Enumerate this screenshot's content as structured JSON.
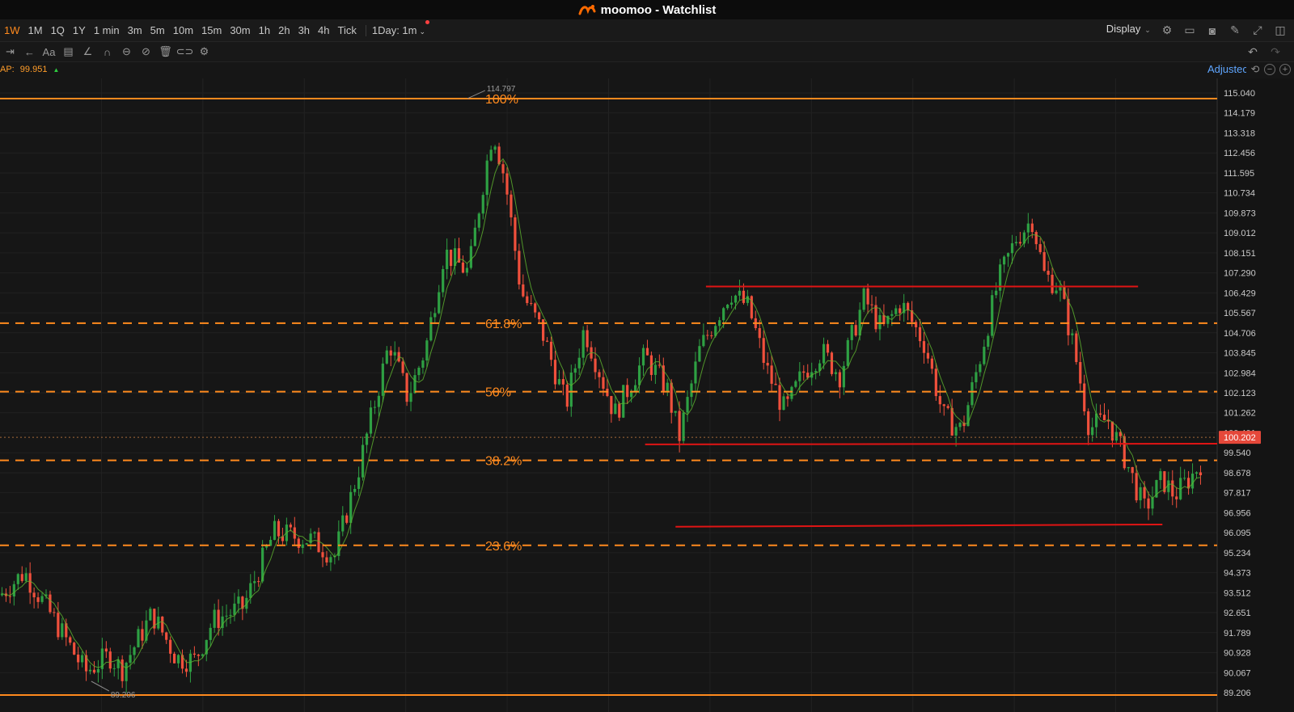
{
  "window": {
    "title": "moomoo - Watchlist"
  },
  "timeframes": [
    "1W",
    "1M",
    "1Q",
    "1Y",
    "1 min",
    "3m",
    "5m",
    "10m",
    "15m",
    "30m",
    "1h",
    "2h",
    "3h",
    "4h",
    "Tick"
  ],
  "active_timeframe": "1W",
  "day_selector": "1Day: 1m",
  "display_label": "Display",
  "indicator": {
    "label": "AP:",
    "value": "99.951"
  },
  "adjusted_label": "Adjustec",
  "colors": {
    "up": "#2ea043",
    "down": "#f0503c",
    "fib": "#ff8a1e",
    "support": "#e01414",
    "accent": "#ff8a1e"
  },
  "chart_data": {
    "type": "candlestick",
    "y_axis": {
      "ylim": [
        89.206,
        115.04
      ],
      "ticks": [
        "115.040",
        "114.179",
        "113.318",
        "112.456",
        "111.595",
        "110.734",
        "109.873",
        "109.012",
        "108.151",
        "107.290",
        "106.429",
        "105.567",
        "104.706",
        "103.845",
        "102.984",
        "102.123",
        "101.262",
        "100.401",
        "99.540",
        "98.678",
        "97.817",
        "96.956",
        "96.095",
        "95.234",
        "94.373",
        "93.512",
        "92.651",
        "91.789",
        "90.928",
        "90.067",
        "89.206"
      ]
    },
    "last_price": "100.202",
    "high_marker": "114.797",
    "low_marker": "89.206",
    "fib_levels": [
      {
        "label": "100%",
        "price": 114.797,
        "style": "solid"
      },
      {
        "label": "61.8%",
        "price": 105.12,
        "style": "dashed"
      },
      {
        "label": "50%",
        "price": 102.17,
        "style": "dashed"
      },
      {
        "label": "38.2%",
        "price": 99.21,
        "style": "dashed"
      },
      {
        "label": "23.6%",
        "price": 95.55,
        "style": "dashed"
      },
      {
        "label": "",
        "price": 89.1,
        "style": "solid"
      }
    ],
    "support_lines": [
      {
        "x0": 0.58,
        "x1": 0.935,
        "p0": 106.7,
        "p1": 106.7
      },
      {
        "x0": 0.53,
        "x1": 1.0,
        "p0": 99.9,
        "p1": 99.93
      },
      {
        "x0": 0.555,
        "x1": 0.955,
        "p0": 96.35,
        "p1": 96.45
      }
    ],
    "price_path": [
      [
        0.0,
        93.4
      ],
      [
        0.02,
        94.4
      ],
      [
        0.045,
        92.3
      ],
      [
        0.07,
        90.1
      ],
      [
        0.09,
        90.8
      ],
      [
        0.1,
        90.2
      ],
      [
        0.125,
        92.6
      ],
      [
        0.145,
        90.7
      ],
      [
        0.16,
        90.6
      ],
      [
        0.175,
        92.3
      ],
      [
        0.2,
        92.9
      ],
      [
        0.225,
        96.1
      ],
      [
        0.255,
        95.8
      ],
      [
        0.275,
        95.1
      ],
      [
        0.295,
        98.9
      ],
      [
        0.32,
        104.3
      ],
      [
        0.335,
        101.9
      ],
      [
        0.35,
        104.1
      ],
      [
        0.365,
        108.2
      ],
      [
        0.385,
        107.3
      ],
      [
        0.395,
        110.6
      ],
      [
        0.405,
        113.5
      ],
      [
        0.415,
        111.3
      ],
      [
        0.428,
        106.5
      ],
      [
        0.445,
        104.8
      ],
      [
        0.465,
        101.6
      ],
      [
        0.48,
        104.9
      ],
      [
        0.505,
        101.2
      ],
      [
        0.53,
        103.7
      ],
      [
        0.548,
        102.3
      ],
      [
        0.558,
        100.2
      ],
      [
        0.575,
        104.0
      ],
      [
        0.6,
        106.5
      ],
      [
        0.615,
        105.8
      ],
      [
        0.63,
        103.1
      ],
      [
        0.645,
        101.3
      ],
      [
        0.66,
        103.0
      ],
      [
        0.675,
        103.9
      ],
      [
        0.69,
        102.9
      ],
      [
        0.71,
        106.2
      ],
      [
        0.725,
        104.8
      ],
      [
        0.74,
        106.0
      ],
      [
        0.76,
        104.2
      ],
      [
        0.775,
        101.1
      ],
      [
        0.79,
        100.5
      ],
      [
        0.805,
        103.6
      ],
      [
        0.82,
        106.9
      ],
      [
        0.835,
        108.8
      ],
      [
        0.848,
        109.6
      ],
      [
        0.858,
        107.2
      ],
      [
        0.87,
        106.7
      ],
      [
        0.882,
        104.1
      ],
      [
        0.895,
        100.6
      ],
      [
        0.91,
        101.0
      ],
      [
        0.925,
        99.2
      ],
      [
        0.94,
        97.1
      ],
      [
        0.955,
        98.4
      ],
      [
        0.965,
        97.7
      ],
      [
        0.98,
        98.6
      ],
      [
        1.0,
        100.2
      ]
    ]
  }
}
